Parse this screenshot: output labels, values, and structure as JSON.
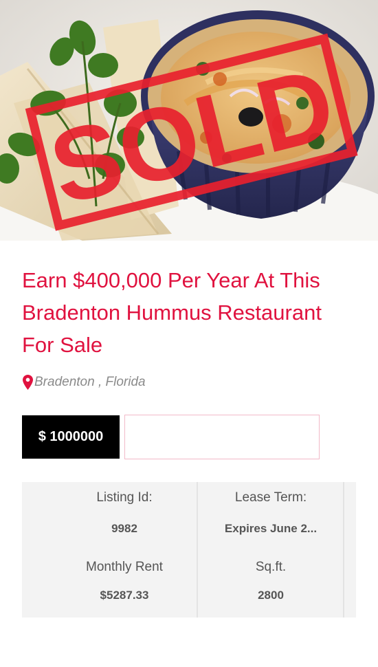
{
  "hero": {
    "image_subject": "hummus-bowl-with-pita-photo",
    "stamp_text": "SOLD",
    "stamp_color": "#e8212e"
  },
  "listing": {
    "title": "Earn $400,000 Per Year At This Bradenton Hummus Restaurant For Sale",
    "location": "Bradenton , Florida",
    "price": "$ 1000000",
    "accent_color": "#e0123f"
  },
  "details": {
    "listing_id_label": "Listing Id:",
    "listing_id_value": "9982",
    "lease_term_label": "Lease Term:",
    "lease_term_value": "Expires June 2...",
    "monthly_rent_label": "Monthly Rent",
    "monthly_rent_value": "$5287.33",
    "sqft_label": "Sq.ft.",
    "sqft_value": "2800"
  },
  "icons": {
    "location": "map-pin-icon"
  }
}
